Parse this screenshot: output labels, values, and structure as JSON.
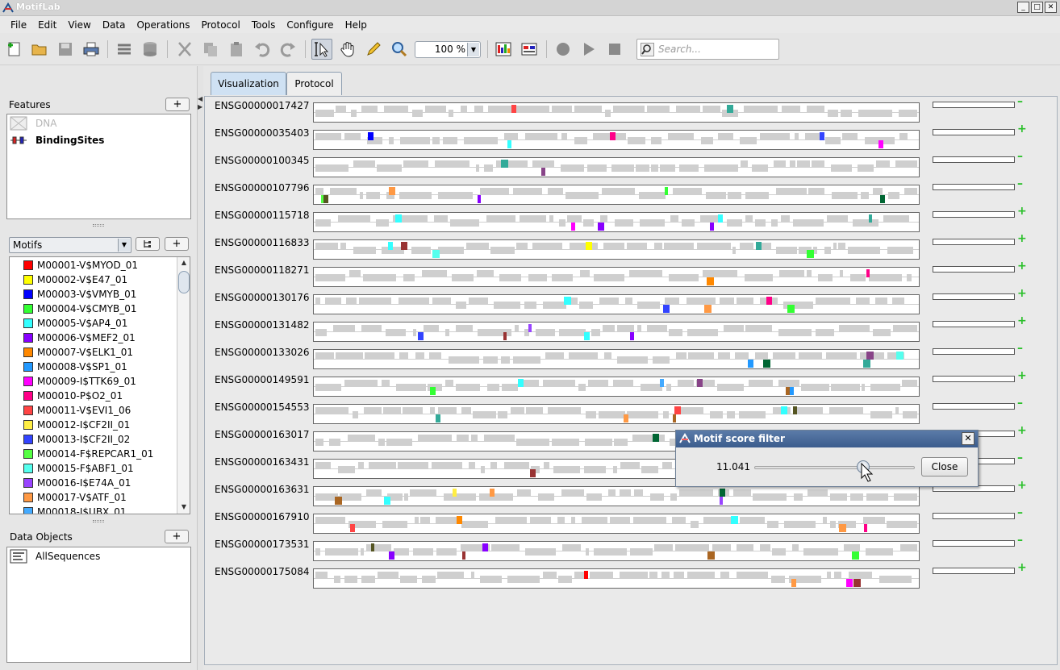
{
  "window": {
    "title": "MotifLab",
    "minimize": "_",
    "maximize": "□",
    "close": "✕"
  },
  "menu": [
    "File",
    "Edit",
    "View",
    "Data",
    "Operations",
    "Protocol",
    "Tools",
    "Configure",
    "Help"
  ],
  "toolbar": {
    "zoom": "100 %",
    "search_placeholder": "Search..."
  },
  "features": {
    "title": "Features",
    "add": "+",
    "items": [
      {
        "label": "DNA",
        "enabled": false
      },
      {
        "label": "BindingSites",
        "enabled": true
      }
    ]
  },
  "motifs": {
    "selector": "Motifs",
    "add": "+",
    "items": [
      {
        "label": "M00001-V$MYOD_01",
        "color": "#ff0000"
      },
      {
        "label": "M00002-V$E47_01",
        "color": "#ffff00"
      },
      {
        "label": "M00003-V$VMYB_01",
        "color": "#0000ff"
      },
      {
        "label": "M00004-V$CMYB_01",
        "color": "#33ff33"
      },
      {
        "label": "M00005-V$AP4_01",
        "color": "#33ffff"
      },
      {
        "label": "M00006-V$MEF2_01",
        "color": "#8800ff"
      },
      {
        "label": "M00007-V$ELK1_01",
        "color": "#ff8800"
      },
      {
        "label": "M00008-V$SP1_01",
        "color": "#2299ff"
      },
      {
        "label": "M00009-I$TTK69_01",
        "color": "#ff00ff"
      },
      {
        "label": "M00010-P$O2_01",
        "color": "#ff0088"
      },
      {
        "label": "M00011-V$EVI1_06",
        "color": "#ff4444"
      },
      {
        "label": "M00012-I$CF2II_01",
        "color": "#ffee44"
      },
      {
        "label": "M00013-I$CF2II_02",
        "color": "#3344ff"
      },
      {
        "label": "M00014-F$REPCAR1_01",
        "color": "#55ff44"
      },
      {
        "label": "M00015-F$ABF1_01",
        "color": "#55ffee"
      },
      {
        "label": "M00016-I$E74A_01",
        "color": "#9944ff"
      },
      {
        "label": "M00017-V$ATF_01",
        "color": "#ff9944"
      },
      {
        "label": "M00018-I$UBX_01",
        "color": "#44aaff"
      }
    ]
  },
  "data_objects": {
    "title": "Data Objects",
    "add": "+",
    "items": [
      {
        "label": "AllSequences"
      }
    ]
  },
  "tabs": [
    {
      "label": "Visualization",
      "active": true
    },
    {
      "label": "Protocol",
      "active": false
    }
  ],
  "sequences": [
    {
      "name": "ENSG00000017427",
      "sign": "–"
    },
    {
      "name": "ENSG00000035403",
      "sign": "+"
    },
    {
      "name": "ENSG00000100345",
      "sign": "–"
    },
    {
      "name": "ENSG00000107796",
      "sign": "–"
    },
    {
      "name": "ENSG00000115718",
      "sign": "+"
    },
    {
      "name": "ENSG00000116833",
      "sign": "+"
    },
    {
      "name": "ENSG00000118271",
      "sign": "+"
    },
    {
      "name": "ENSG00000130176",
      "sign": "+"
    },
    {
      "name": "ENSG00000131482",
      "sign": "+"
    },
    {
      "name": "ENSG00000133026",
      "sign": "–"
    },
    {
      "name": "ENSG00000149591",
      "sign": "+"
    },
    {
      "name": "ENSG00000154553",
      "sign": "–"
    },
    {
      "name": "ENSG00000163017",
      "sign": "+"
    },
    {
      "name": "ENSG00000163431",
      "sign": "–"
    },
    {
      "name": "ENSG00000163631",
      "sign": "+"
    },
    {
      "name": "ENSG00000167910",
      "sign": "–"
    },
    {
      "name": "ENSG00000173531",
      "sign": "–"
    },
    {
      "name": "ENSG00000175084",
      "sign": "+"
    }
  ],
  "score_filter_dialog": {
    "title": "Motif score filter",
    "close_x": "✕",
    "value": "11.041",
    "slider_fraction": 0.68,
    "close_button": "Close"
  }
}
